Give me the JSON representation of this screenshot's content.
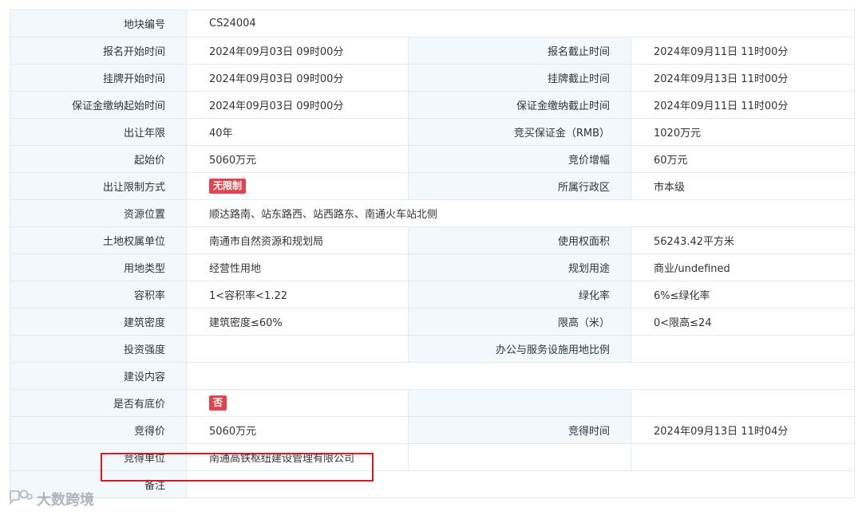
{
  "rows": [
    {
      "l1": "地块编号",
      "v1": "CS24004",
      "l2": "",
      "v2": ""
    },
    {
      "l1": "报名开始时间",
      "v1": "2024年09月03日 09时00分",
      "l2": "报名截止时间",
      "v2": "2024年09月11日 11时00分"
    },
    {
      "l1": "挂牌开始时间",
      "v1": "2024年09月03日 09时00分",
      "l2": "挂牌截止时间",
      "v2": "2024年09月13日 11时00分"
    },
    {
      "l1": "保证金缴纳起始时间",
      "v1": "2024年09月03日 09时00分",
      "l2": "保证金缴纳截止时间",
      "v2": "2024年09月11日 11时00分"
    },
    {
      "l1": "出让年限",
      "v1": "40年",
      "l2": "竞买保证金（RMB）",
      "v2": "1020万元"
    },
    {
      "l1": "起始价",
      "v1": "5060万元",
      "l2": "竞价增幅",
      "v2": "60万元"
    },
    {
      "l1": "出让限制方式",
      "v1": "无限制",
      "l2": "所属行政区",
      "v2": "市本级"
    },
    {
      "l1": "资源位置",
      "v1": "顺达路南、站东路西、站西路东、南通火车站北侧",
      "l2": "",
      "v2": ""
    },
    {
      "l1": "土地权属单位",
      "v1": "南通市自然资源和规划局",
      "l2": "使用权面积",
      "v2": "56243.42平方米"
    },
    {
      "l1": "用地类型",
      "v1": "经营性用地",
      "l2": "规划用途",
      "v2": "商业/undefined"
    },
    {
      "l1": "容积率",
      "v1": "1<容积率<1.22",
      "l2": "绿化率",
      "v2": "6%≤绿化率"
    },
    {
      "l1": "建筑密度",
      "v1": "建筑密度≤60%",
      "l2": "限高（米）",
      "v2": "0<限高≤24"
    },
    {
      "l1": "投资强度",
      "v1": "",
      "l2": "办公与服务设施用地比例",
      "v2": ""
    },
    {
      "l1": "建设内容",
      "v1": "",
      "l2": "",
      "v2": ""
    },
    {
      "l1": "是否有底价",
      "v1": "否",
      "l2": "",
      "v2": ""
    },
    {
      "l1": "竞得价",
      "v1": "5060万元",
      "l2": "竞得时间",
      "v2": "2024年09月13日 11时04分"
    },
    {
      "l1": "竞得单位",
      "v1": "南通高铁枢纽建设管理有限公司",
      "l2": "",
      "v2": ""
    },
    {
      "l1": "备注",
      "v1": "",
      "l2": "",
      "v2": ""
    }
  ],
  "watermark": {
    "text": "大数跨境",
    "icon": "chat-bubble-logo-icon"
  },
  "colors": {
    "label_bg": "#f3f8fd",
    "border": "#e3e9f1",
    "badge": "#e0454f",
    "highlight": "#e0161f"
  }
}
